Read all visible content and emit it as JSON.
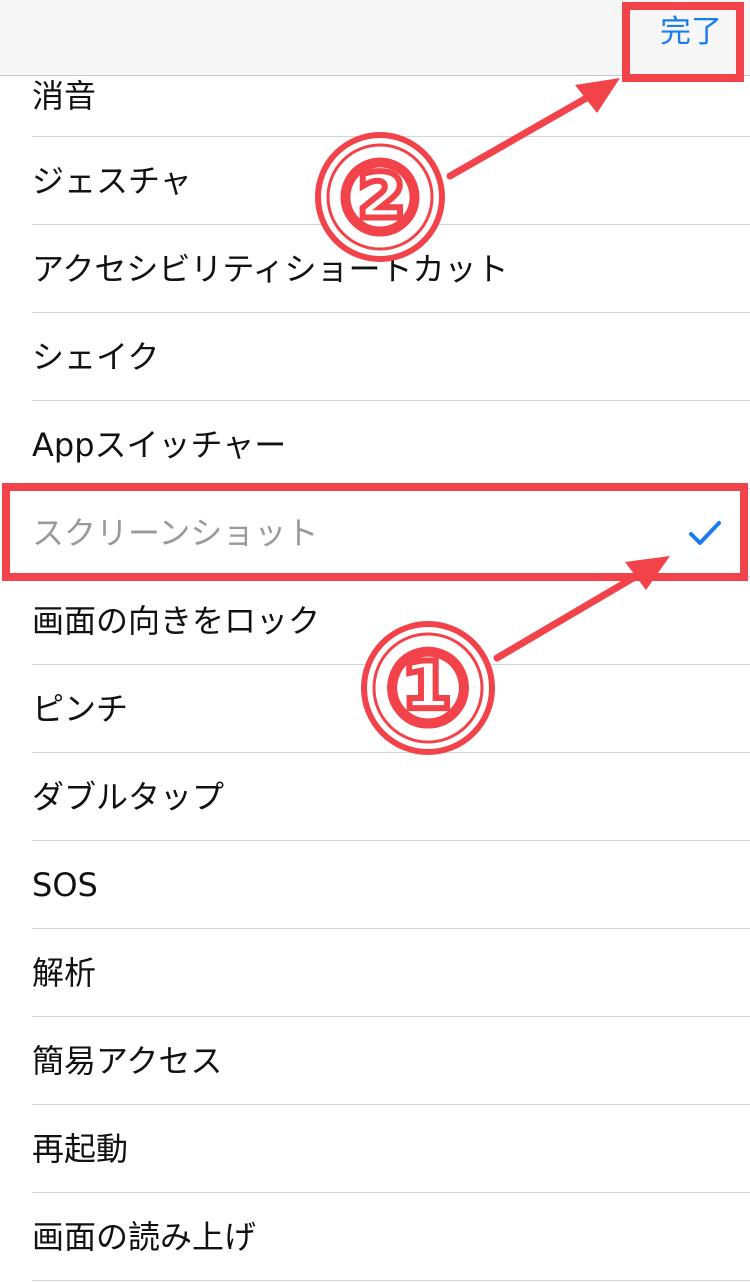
{
  "navbar": {
    "done_label": "完了"
  },
  "list": {
    "items": [
      {
        "label": "消音",
        "selected": false,
        "dimmed": false
      },
      {
        "label": "ジェスチャ",
        "selected": false,
        "dimmed": false
      },
      {
        "label": "アクセシビリティショートカット",
        "selected": false,
        "dimmed": false
      },
      {
        "label": "シェイク",
        "selected": false,
        "dimmed": false
      },
      {
        "label": "Appスイッチャー",
        "selected": false,
        "dimmed": false
      },
      {
        "label": "スクリーンショット",
        "selected": true,
        "dimmed": true
      },
      {
        "label": "画面の向きをロック",
        "selected": false,
        "dimmed": false
      },
      {
        "label": "ピンチ",
        "selected": false,
        "dimmed": false
      },
      {
        "label": "ダブルタップ",
        "selected": false,
        "dimmed": false
      },
      {
        "label": "SOS",
        "selected": false,
        "dimmed": false
      },
      {
        "label": "解析",
        "selected": false,
        "dimmed": false
      },
      {
        "label": "簡易アクセス",
        "selected": false,
        "dimmed": false
      },
      {
        "label": "再起動",
        "selected": false,
        "dimmed": false
      },
      {
        "label": "画面の読み上げ",
        "selected": false,
        "dimmed": false
      }
    ]
  },
  "annotations": {
    "step1_label": "①",
    "step2_label": "②",
    "highlight_color": "#f2424a"
  },
  "colors": {
    "accent": "#1a7cf2",
    "annotation": "#f2424a"
  },
  "icons": {
    "selected_marker": "checkmark-icon",
    "arrows": "arrow-icon"
  }
}
